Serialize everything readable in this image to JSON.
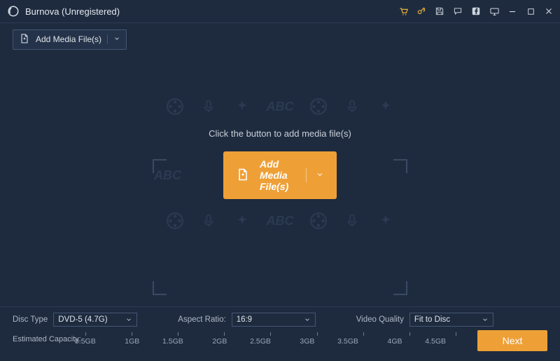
{
  "titlebar": {
    "title": "Burnova (Unregistered)"
  },
  "toolbar": {
    "add_label": "Add Media File(s)"
  },
  "main": {
    "hint": "Click the button to add media file(s)",
    "add_label": "Add Media File(s)",
    "watermark_text": "ABC"
  },
  "bottom": {
    "disc_type_label": "Disc Type",
    "disc_type_value": "DVD-5 (4.7G)",
    "aspect_label": "Aspect Ratio:",
    "aspect_value": "16:9",
    "quality_label": "Video Quality",
    "quality_value": "Fit to Disc",
    "capacity_label": "Estimated Capacity:",
    "ticks": [
      "0.5GB",
      "1GB",
      "1.5GB",
      "2GB",
      "2.5GB",
      "3GB",
      "3.5GB",
      "4GB",
      "4.5GB"
    ],
    "next_label": "Next"
  }
}
